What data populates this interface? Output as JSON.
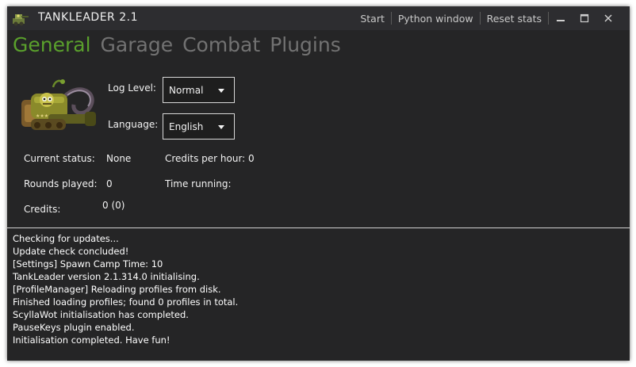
{
  "window": {
    "title": "TANKLEADER 2.1",
    "actions": [
      "Start",
      "Python window",
      "Reset stats"
    ]
  },
  "tabs": [
    {
      "label": "General",
      "active": true
    },
    {
      "label": "Garage",
      "active": false
    },
    {
      "label": "Combat",
      "active": false
    },
    {
      "label": "Plugins",
      "active": false
    }
  ],
  "settings": {
    "log_level_label": "Log Level:",
    "log_level_value": "Normal",
    "language_label": "Language:",
    "language_value": "English"
  },
  "stats": {
    "current_status_label": "Current status:",
    "current_status_value": "None",
    "credits_per_hour_label": "Credits per hour:",
    "credits_per_hour_value": "0",
    "rounds_played_label": "Rounds played:",
    "rounds_played_value": "0",
    "time_running_label": "Time running:",
    "credits_label": "Credits:",
    "credits_value": "0 (0)"
  },
  "log": {
    "lines": [
      "Checking for updates...",
      "Update check concluded!",
      "[Settings] Spawn Camp Time: 10",
      "TankLeader version 2.1.314.0 initialising.",
      "[ProfileManager] Reloading profiles from disk.",
      "Finished loading profiles; found 0 profiles in total.",
      "ScyllaWot initialisation has completed.",
      "PauseKeys plugin enabled.",
      "Initialisation completed. Have fun!"
    ]
  },
  "colors": {
    "background": "#252526",
    "titlebar": "#2d2d30",
    "accent": "#5aa02c",
    "inactive_tab": "#727272"
  },
  "icons": [
    "tank-logo-icon",
    "tank-mascot-icon",
    "minimize-icon",
    "maximize-icon",
    "close-icon",
    "chevron-down-icon"
  ]
}
